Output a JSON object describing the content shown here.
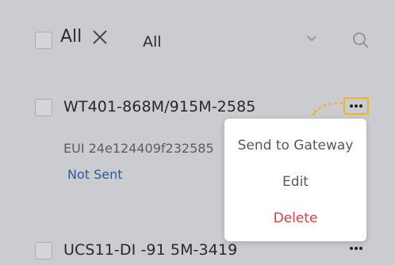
{
  "toolbar": {
    "select_all_label": "All",
    "filter_value": "All"
  },
  "devices": [
    {
      "name": "WT401-868M/915M-2585",
      "eui": "EUI 24e124409f232585",
      "status": "Not Sent"
    },
    {
      "name": "UCS11-DI -91 5M-3419"
    }
  ],
  "context_menu": {
    "items": [
      {
        "label": "Send to Gateway"
      },
      {
        "label": "Edit"
      },
      {
        "label": "Delete"
      }
    ]
  },
  "colors": {
    "highlight": "#f0b323",
    "delete": "#d93f3f",
    "status": "#2a5c9c"
  },
  "icons": {
    "clear": "close-icon",
    "dropdown": "chevron-down-icon",
    "search": "search-icon",
    "more": "more-horizontal-icon"
  }
}
